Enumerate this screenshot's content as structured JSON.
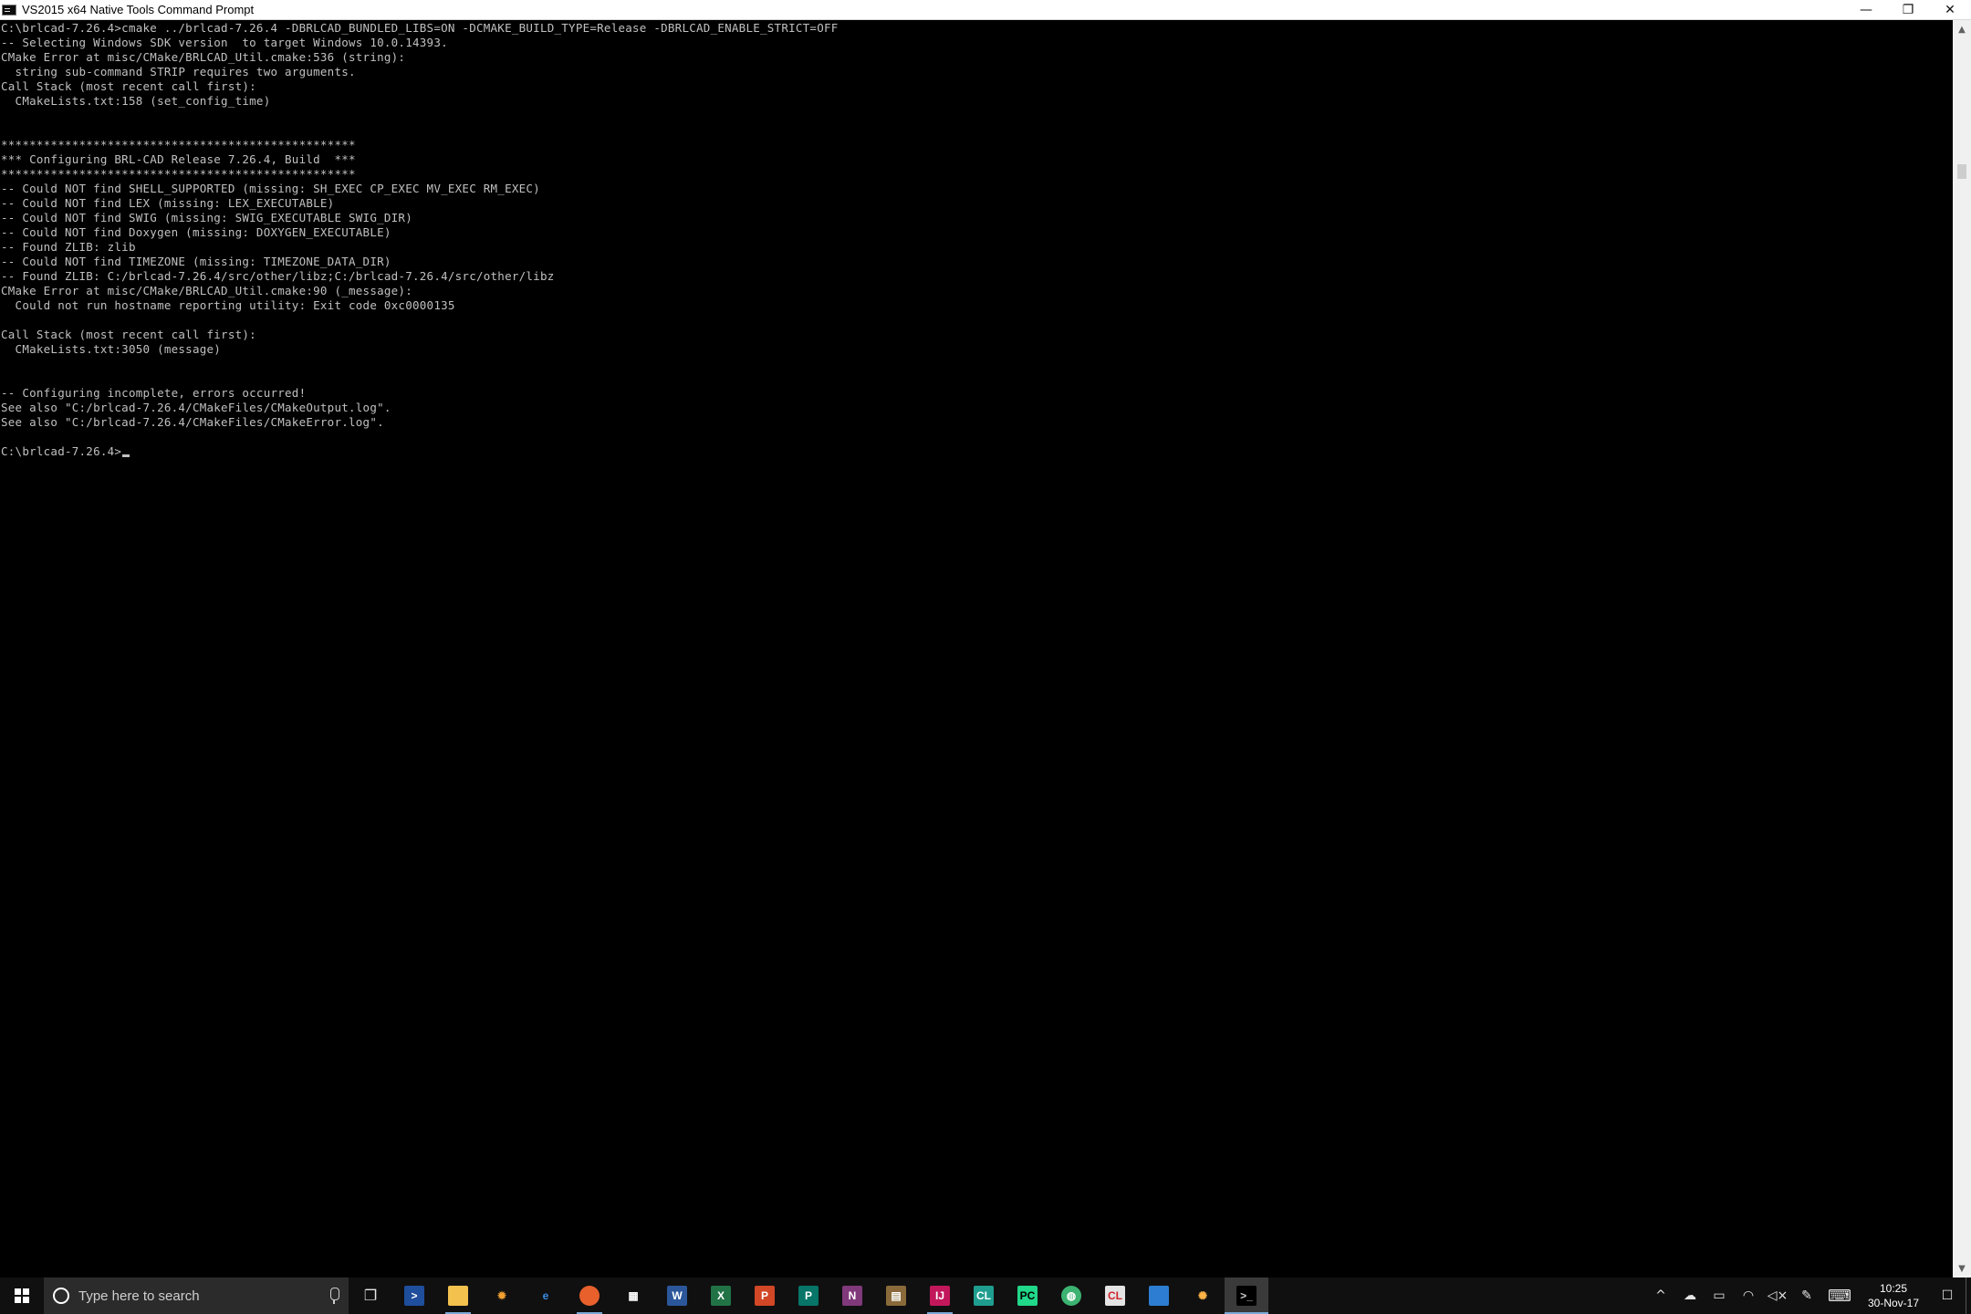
{
  "window": {
    "title": "VS2015 x64 Native Tools Command Prompt",
    "controls": {
      "minimize": "—",
      "restore": "❐",
      "close": "✕"
    }
  },
  "console": {
    "lines": [
      "C:\\brlcad-7.26.4>cmake ../brlcad-7.26.4 -DBRLCAD_BUNDLED_LIBS=ON -DCMAKE_BUILD_TYPE=Release -DBRLCAD_ENABLE_STRICT=OFF",
      "-- Selecting Windows SDK version  to target Windows 10.0.14393.",
      "CMake Error at misc/CMake/BRLCAD_Util.cmake:536 (string):",
      "  string sub-command STRIP requires two arguments.",
      "Call Stack (most recent call first):",
      "  CMakeLists.txt:158 (set_config_time)",
      "",
      "",
      "**************************************************",
      "*** Configuring BRL-CAD Release 7.26.4, Build  ***",
      "**************************************************",
      "-- Could NOT find SHELL_SUPPORTED (missing: SH_EXEC CP_EXEC MV_EXEC RM_EXEC)",
      "-- Could NOT find LEX (missing: LEX_EXECUTABLE)",
      "-- Could NOT find SWIG (missing: SWIG_EXECUTABLE SWIG_DIR)",
      "-- Could NOT find Doxygen (missing: DOXYGEN_EXECUTABLE)",
      "-- Found ZLIB: zlib",
      "-- Could NOT find TIMEZONE (missing: TIMEZONE_DATA_DIR)",
      "-- Found ZLIB: C:/brlcad-7.26.4/src/other/libz;C:/brlcad-7.26.4/src/other/libz",
      "CMake Error at misc/CMake/BRLCAD_Util.cmake:90 (_message):",
      "  Could not run hostname reporting utility: Exit code 0xc0000135",
      "",
      "Call Stack (most recent call first):",
      "  CMakeLists.txt:3050 (message)",
      "",
      "",
      "-- Configuring incomplete, errors occurred!",
      "See also \"C:/brlcad-7.26.4/CMakeFiles/CMakeOutput.log\".",
      "See also \"C:/brlcad-7.26.4/CMakeFiles/CMakeError.log\".",
      ""
    ],
    "prompt": "C:\\brlcad-7.26.4>"
  },
  "scrollbar": {
    "up_arrow": "▲",
    "down_arrow": "▼"
  },
  "taskbar": {
    "search": {
      "placeholder": "Type here to search"
    },
    "task_view_glyph": "❐",
    "apps": [
      {
        "name": "powershell",
        "glyph": ">",
        "bg": "#1f4e9c",
        "fg": "#ffffff",
        "round": false,
        "open": false
      },
      {
        "name": "file-explorer",
        "glyph": "",
        "bg": "#f2c14e",
        "fg": "#ffffff",
        "round": false,
        "open": true
      },
      {
        "name": "sun-app",
        "glyph": "✹",
        "bg": "transparent",
        "fg": "#f0a030",
        "round": false,
        "open": false
      },
      {
        "name": "edge",
        "glyph": "e",
        "bg": "transparent",
        "fg": "#3a8ee6",
        "round": false,
        "open": false
      },
      {
        "name": "firefox",
        "glyph": "",
        "bg": "#e8602c",
        "fg": "#ffffff",
        "round": true,
        "open": true
      },
      {
        "name": "store",
        "glyph": "▦",
        "bg": "transparent",
        "fg": "#ffffff",
        "round": false,
        "open": false
      },
      {
        "name": "word",
        "glyph": "W",
        "bg": "#2b579a",
        "fg": "#ffffff",
        "round": false,
        "open": false
      },
      {
        "name": "excel",
        "glyph": "X",
        "bg": "#217346",
        "fg": "#ffffff",
        "round": false,
        "open": false
      },
      {
        "name": "powerpoint",
        "glyph": "P",
        "bg": "#d24726",
        "fg": "#ffffff",
        "round": false,
        "open": false
      },
      {
        "name": "publisher",
        "glyph": "P",
        "bg": "#077568",
        "fg": "#ffffff",
        "round": false,
        "open": false
      },
      {
        "name": "onenote",
        "glyph": "N",
        "bg": "#80397b",
        "fg": "#ffffff",
        "round": false,
        "open": false
      },
      {
        "name": "archive-app",
        "glyph": "▤",
        "bg": "#8a6a3a",
        "fg": "#ffffff",
        "round": false,
        "open": false
      },
      {
        "name": "intellij",
        "glyph": "IJ",
        "bg": "#c2185b",
        "fg": "#ffffff",
        "round": false,
        "open": true
      },
      {
        "name": "clion",
        "glyph": "CL",
        "bg": "#1f9e8f",
        "fg": "#ffffff",
        "round": false,
        "open": false
      },
      {
        "name": "pycharm",
        "glyph": "PC",
        "bg": "#21d789",
        "fg": "#000000",
        "round": false,
        "open": false
      },
      {
        "name": "globe-app",
        "glyph": "◍",
        "bg": "#3cb371",
        "fg": "#ffffff",
        "round": true,
        "open": false
      },
      {
        "name": "cl-app",
        "glyph": "CL",
        "bg": "#e4e4e4",
        "fg": "#d0262d",
        "round": false,
        "open": false
      },
      {
        "name": "window-app",
        "glyph": "",
        "bg": "#2d7dd2",
        "fg": "#ffffff",
        "round": false,
        "open": false
      },
      {
        "name": "settings-sun-app",
        "glyph": "✺",
        "bg": "transparent",
        "fg": "#ffb347",
        "round": false,
        "open": false
      },
      {
        "name": "command-prompt",
        "glyph": ">_",
        "bg": "#000000",
        "fg": "#cccccc",
        "round": false,
        "open": true,
        "active": true
      }
    ],
    "tray": {
      "chevron": "^",
      "cloud": "☁",
      "battery": "▭",
      "wifi": "◠",
      "volume": "◁×",
      "pen": "✎",
      "keyboard": "⌨"
    },
    "clock": {
      "time": "10:25",
      "date": "30-Nov-17"
    },
    "notification_glyph": "☐"
  }
}
